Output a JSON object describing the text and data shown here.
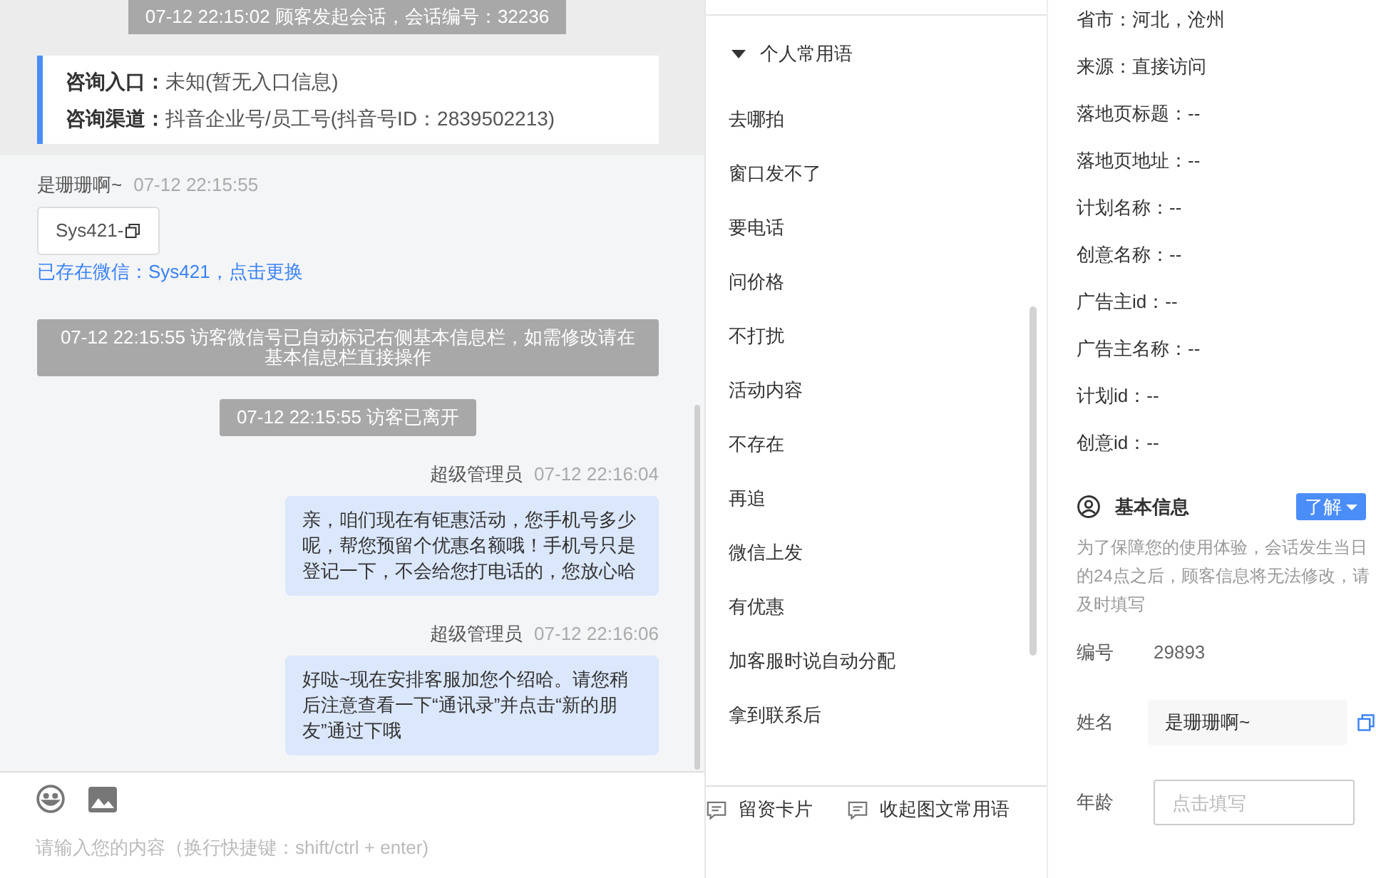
{
  "chat": {
    "session_notice": "07-12 22:15:02 顾客发起会话，会话编号：32236",
    "source_card": [
      {
        "label": "咨询入口：",
        "value": "未知(暂无入口信息)"
      },
      {
        "label": "咨询渠道：",
        "value": "抖音企业号/员工号(抖音号ID：2839502213)"
      }
    ],
    "messages": [
      {
        "kind": "visitor",
        "sender": "是珊珊啊~",
        "time": "07-12 22:15:55",
        "chip": "Sys421-",
        "link": "已存在微信：Sys421，点击更换"
      },
      {
        "kind": "system",
        "text": "07-12 22:15:55 访客微信号已自动标记右侧基本信息栏，如需修改请在基本信息栏直接操作"
      },
      {
        "kind": "system",
        "text": "07-12 22:15:55 访客已离开"
      },
      {
        "kind": "agent",
        "sender": "超级管理员",
        "time": "07-12 22:16:04",
        "text": "亲，咱们现在有钜惠活动，您手机号多少呢，帮您预留个优惠名额哦！手机号只是登记一下，不会给您打电话的，您放心哈"
      },
      {
        "kind": "agent",
        "sender": "超级管理员",
        "time": "07-12 22:16:06",
        "text": "好哒~现在安排客服加您个绍哈。请您稍后注意查看一下“通讯录”并点击“新的朋友”通过下哦"
      }
    ],
    "input": {
      "placeholder": "请输入您的内容（换行快捷键：shift/ctrl + enter)"
    }
  },
  "phrases": {
    "group": {
      "title": "个人常用语",
      "expanded": true
    },
    "items": [
      "去哪拍",
      "窗口发不了",
      "要电话",
      "问价格",
      "不打扰",
      "活动内容",
      "不存在",
      "再追",
      "微信上发",
      "有优惠",
      "加客服时说自动分配",
      "拿到联系后"
    ],
    "toolbar": [
      "留资卡片",
      "收起图文常用语"
    ]
  },
  "info": {
    "fields": [
      "省市：河北，沧州",
      "来源：直接访问",
      "落地页标题：--",
      "落地页地址：--",
      "计划名称：--",
      "创意名称：--",
      "广告主id：--",
      "广告主名称：--",
      "计划id：--",
      "创意id：--"
    ],
    "basic": {
      "title": "基本信息",
      "button": "了解",
      "note": "为了保障您的使用体验，会话发生当日的24点之后，顾客信息将无法修改，请及时填写",
      "rows": [
        {
          "kind": "text",
          "label": "编号",
          "value": "29893"
        },
        {
          "kind": "readonly",
          "label": "姓名",
          "value": "是珊珊啊~"
        },
        {
          "kind": "input",
          "label": "年龄",
          "placeholder": "点击填写"
        }
      ]
    }
  }
}
